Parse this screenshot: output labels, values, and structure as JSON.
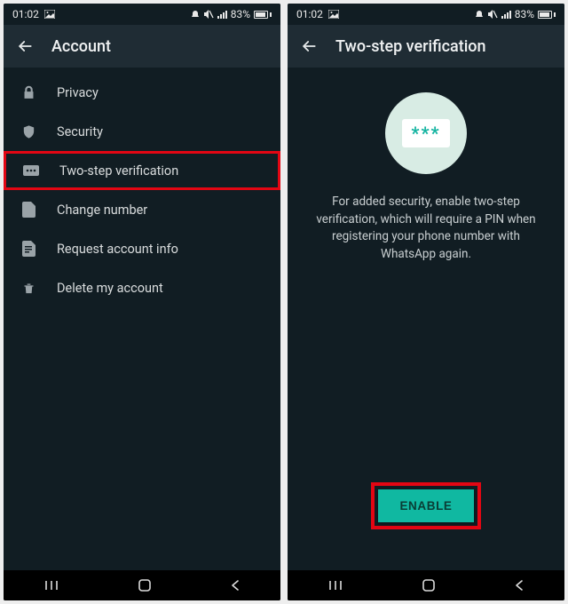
{
  "statusbar": {
    "time": "01:02",
    "battery_pct": "83%"
  },
  "left": {
    "appbar_title": "Account",
    "items": [
      {
        "icon": "lock",
        "label": "Privacy"
      },
      {
        "icon": "shield",
        "label": "Security"
      },
      {
        "icon": "pin",
        "label": "Two-step verification"
      },
      {
        "icon": "doc",
        "label": "Change number"
      },
      {
        "icon": "page",
        "label": "Request account info"
      },
      {
        "icon": "trash",
        "label": "Delete my account"
      }
    ]
  },
  "right": {
    "appbar_title": "Two-step verification",
    "hero_stars": "***",
    "description": "For added security, enable two-step verification, which will require a PIN when registering your phone number with WhatsApp again.",
    "enable_label": "ENABLE"
  },
  "colors": {
    "accent": "#10b8a1",
    "highlight": "#e30613",
    "bg": "#111d23",
    "appbar": "#1f2c34"
  }
}
